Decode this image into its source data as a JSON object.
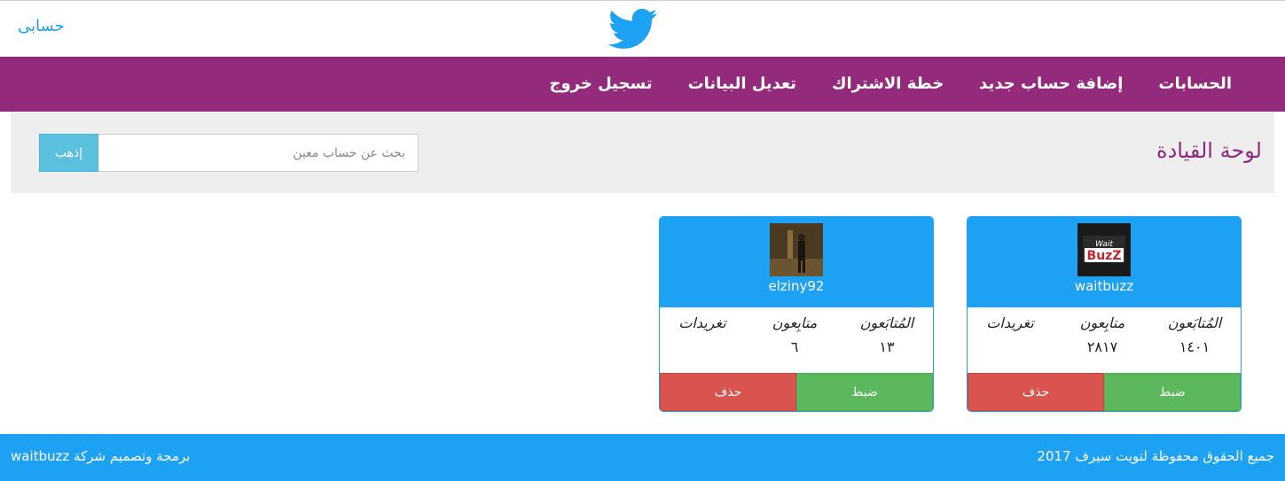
{
  "header": {
    "account_link": "حسابى",
    "logo_icon": "twitter-bird-icon",
    "brand_color": "#1da1f2"
  },
  "nav": {
    "items": [
      "الحسابات",
      "إضافة حساب جديد",
      "خطة الاشتراك",
      "تعديل البيانات",
      "تسجيل خروج"
    ],
    "background": "#942a7b"
  },
  "dashboard": {
    "title": "لوحة القيادة",
    "search_placeholder": "بحث عن حساب معين",
    "go_label": "إذهب"
  },
  "cards": [
    {
      "handle": "waitbuzz",
      "avatar": "waitbuzz-logo",
      "stats": [
        {
          "label": "المُتابَعون",
          "value": "١٤٠١"
        },
        {
          "label": "متابِعون",
          "value": "٢٨١٧"
        },
        {
          "label": "تغريدات",
          "value": ""
        }
      ],
      "settings_label": "ضبط",
      "delete_label": "حذف"
    },
    {
      "handle": "elziny92",
      "avatar": "user-photo",
      "stats": [
        {
          "label": "المُتابَعون",
          "value": "١٣"
        },
        {
          "label": "متابِعون",
          "value": "٦"
        },
        {
          "label": "تغريدات",
          "value": ""
        }
      ],
      "settings_label": "ضبط",
      "delete_label": "حذف"
    }
  ],
  "footer": {
    "copyright": "جميع الحقوق محفوظة لتويت سيرف 2017",
    "credit": "برمجة وتصميم شركة waitbuzz"
  }
}
